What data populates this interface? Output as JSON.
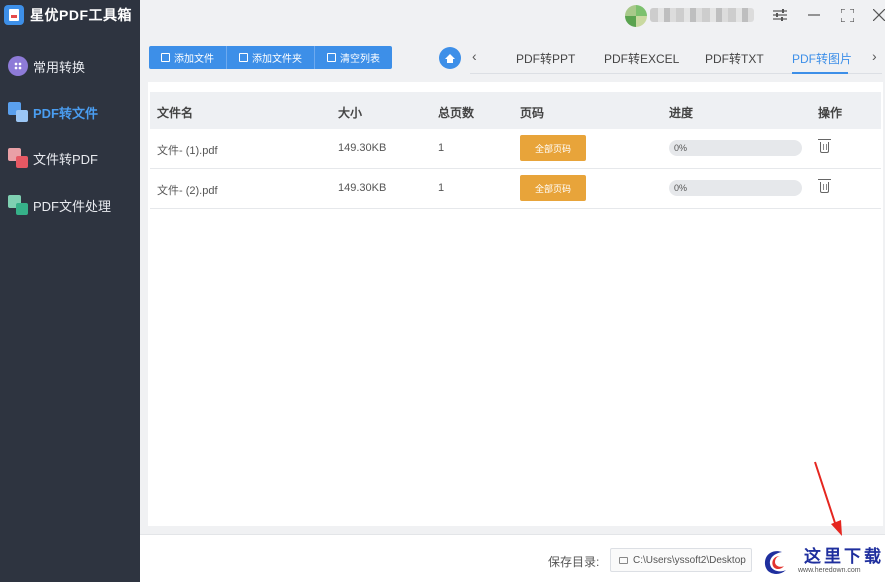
{
  "app": {
    "title": "星优PDF工具箱"
  },
  "sidebar": {
    "items": [
      {
        "label": "常用转换"
      },
      {
        "label": "PDF转文件"
      },
      {
        "label": "文件转PDF"
      },
      {
        "label": "PDF文件处理"
      }
    ]
  },
  "toolbar": {
    "add_file": "添加文件",
    "add_folder": "添加文件夹",
    "clear_list": "清空列表"
  },
  "tabs": [
    {
      "label": "PDF转PPT"
    },
    {
      "label": "PDF转EXCEL"
    },
    {
      "label": "PDF转TXT"
    },
    {
      "label": "PDF转图片"
    }
  ],
  "table": {
    "headers": {
      "name": "文件名",
      "size": "大小",
      "pages": "总页数",
      "range": "页码",
      "progress": "进度",
      "action": "操作"
    },
    "rows": [
      {
        "name": "文件- (1).pdf",
        "size": "149.30KB",
        "pages": "1",
        "range": "全部页码",
        "progress": "0%",
        "progress_value": 0
      },
      {
        "name": "文件- (2).pdf",
        "size": "149.30KB",
        "pages": "1",
        "range": "全部页码",
        "progress": "0%",
        "progress_value": 0
      }
    ]
  },
  "footer": {
    "save_label": "保存目录:",
    "save_path": "C:\\Users\\yssoft2\\Desktop"
  },
  "watermark": {
    "text": "这里下载",
    "url": "www.heredown.com"
  },
  "colors": {
    "accent": "#3d8fe8",
    "sidebar_bg": "#2e3440",
    "page_btn": "#e8a43a"
  },
  "icons": {
    "sidebar": [
      "grid-icon",
      "pdf-to-file-icon",
      "file-to-pdf-icon",
      "pdf-process-icon"
    ],
    "window": [
      "settings-icon",
      "minimize-icon",
      "maximize-icon",
      "close-icon"
    ]
  }
}
